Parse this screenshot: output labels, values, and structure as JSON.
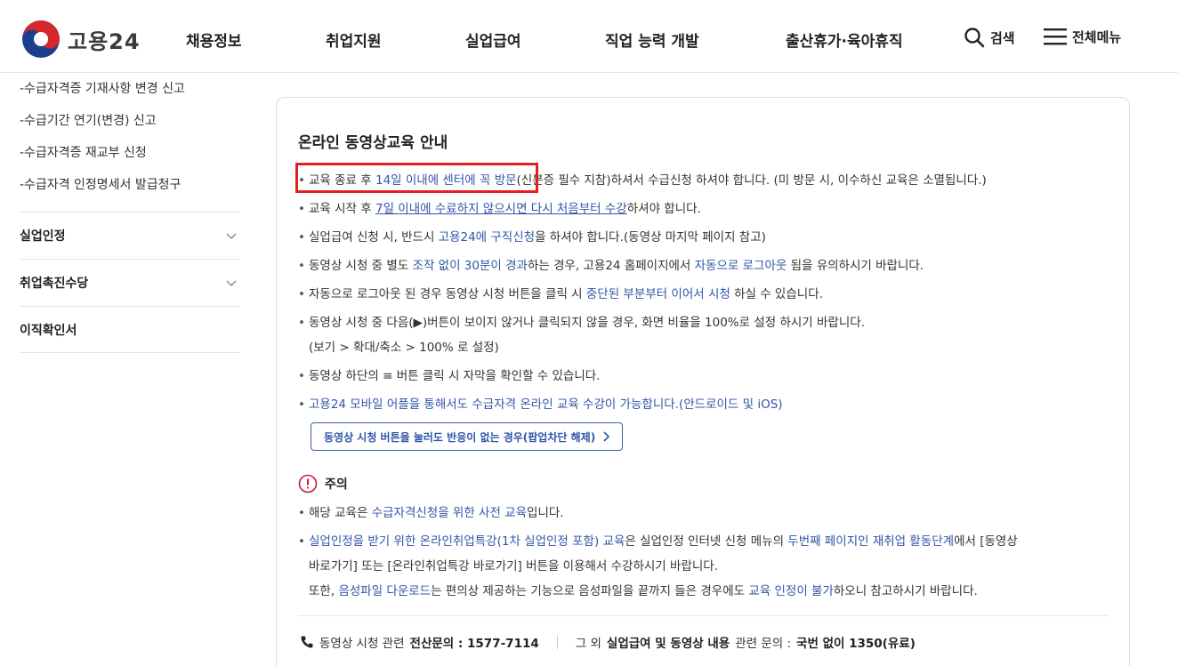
{
  "header": {
    "logo_text": "고용24",
    "nav": [
      "채용정보",
      "취업지원",
      "실업급여",
      "직업 능력 개발",
      "출산휴가·육아휴직"
    ],
    "search_label": "검색",
    "menu_label": "전체메뉴"
  },
  "sidebar": {
    "sub_items": [
      "-수급자격증 기재사항 변경 신고",
      "-수급기간 연기(변경) 신고",
      "-수급자격증 재교부 신청",
      "-수급자격 인정명세서 발급청구"
    ],
    "groups": [
      "실업인정",
      "취업촉진수당",
      "이직확인서"
    ]
  },
  "content": {
    "title": "온라인 동영상교육 안내",
    "b1": {
      "a": "교육 종료 후 ",
      "b": "14일 이내에 센터에 꼭 방문",
      "c": "(신분증 필수 지참)하셔서 수급신청 하셔야 합니다. (미 방문 시, 이수하신 교육은 소멸됩니다.)"
    },
    "b2": {
      "a": "교육 시작 후 ",
      "b": "7일 이내에 수료하지 않으시면 다시 처음부터 수강",
      "c": "하셔야 합니다."
    },
    "b3": {
      "a": "실업급여 신청 시, 반드시 ",
      "b": "고용24에 구직신청",
      "c": "을 하셔야 합니다.(동영상 마지막 페이지 참고)"
    },
    "b4": {
      "a": "동영상 시청 중 별도 ",
      "b": "조작 없이 30분이 경과",
      "c": "하는 경우, 고용24 홈페이지에서 ",
      "d": "자동으로 로그아웃",
      "e": " 됨을 유의하시기 바랍니다."
    },
    "b5": {
      "a": "자동으로 로그아웃 된 경우 동영상 시청 버튼을 클릭 시 ",
      "b": "중단된 부분부터 이어서 시청",
      "c": " 하실 수 있습니다."
    },
    "b6": {
      "a": "동영상 시청 중 다음(▶)버튼이 보이지 않거나 클릭되지 않을 경우, 화면 비율을 100%로 설정 하시기 바랍니다.",
      "b": "(보기 > 확대/축소 > 100% 로 설정)"
    },
    "b7": "동영상 하단의 ≡ 버튼 클릭 시 자막을 확인할 수 있습니다.",
    "b8": "고용24 모바일 어플을 통해서도 수급자격 온라인 교육 수강이 가능합니다.(안드로이드 및 iOS)",
    "popup_button": "동영상 시청 버튼을 눌러도 반응이 없는 경우(팝업차단 해제)",
    "notice_title": "주의",
    "n1": {
      "a": "해당 교육은 ",
      "b": "수급자격신청을 위한 사전 교육",
      "c": "입니다."
    },
    "n2": {
      "a": "실업인정을 받기 위한 온라인취업특강(1차 실업인정 포함) 교육",
      "b": "은 실업인정 인터넷 신청 메뉴의 ",
      "c": "두번째 페이지인 재취업 활동단계",
      "d": "에서 [동영상",
      "e": "바로가기] 또는 [온라인취업특강 바로가기] 버튼을 이용해서 수강하시기 바랍니다.",
      "f": "또한, ",
      "g": "음성파일 다운로드",
      "h": "는 편의상 제공하는 기능으로 음성파일을 끝까지 들은 경우에도 ",
      "i": "교육 인정이 불가",
      "j": "하오니 참고하시기 바랍니다."
    },
    "contact": {
      "a": "동영상 시청 관련 ",
      "b": "전산문의 : 1577-7114",
      "c": "그 외 ",
      "d": "실업급여 및 동영상 내용",
      "e": " 관련 문의 : ",
      "f": "국번 없이 1350(유료)"
    }
  }
}
